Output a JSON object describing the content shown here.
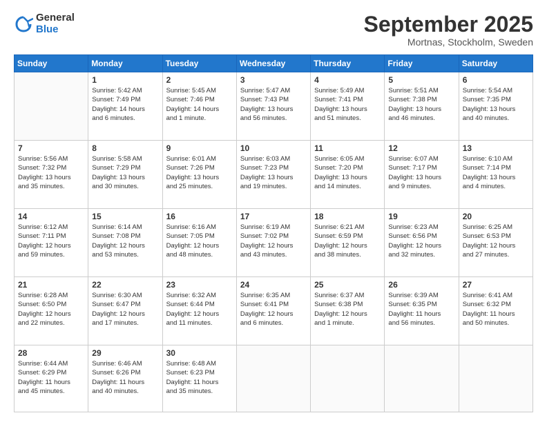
{
  "header": {
    "logo": {
      "general": "General",
      "blue": "Blue"
    },
    "title": "September 2025",
    "location": "Mortnas, Stockholm, Sweden"
  },
  "calendar": {
    "days_of_week": [
      "Sunday",
      "Monday",
      "Tuesday",
      "Wednesday",
      "Thursday",
      "Friday",
      "Saturday"
    ],
    "weeks": [
      [
        {
          "day": "",
          "info": ""
        },
        {
          "day": "1",
          "info": "Sunrise: 5:42 AM\nSunset: 7:49 PM\nDaylight: 14 hours\nand 6 minutes."
        },
        {
          "day": "2",
          "info": "Sunrise: 5:45 AM\nSunset: 7:46 PM\nDaylight: 14 hours\nand 1 minute."
        },
        {
          "day": "3",
          "info": "Sunrise: 5:47 AM\nSunset: 7:43 PM\nDaylight: 13 hours\nand 56 minutes."
        },
        {
          "day": "4",
          "info": "Sunrise: 5:49 AM\nSunset: 7:41 PM\nDaylight: 13 hours\nand 51 minutes."
        },
        {
          "day": "5",
          "info": "Sunrise: 5:51 AM\nSunset: 7:38 PM\nDaylight: 13 hours\nand 46 minutes."
        },
        {
          "day": "6",
          "info": "Sunrise: 5:54 AM\nSunset: 7:35 PM\nDaylight: 13 hours\nand 40 minutes."
        }
      ],
      [
        {
          "day": "7",
          "info": "Sunrise: 5:56 AM\nSunset: 7:32 PM\nDaylight: 13 hours\nand 35 minutes."
        },
        {
          "day": "8",
          "info": "Sunrise: 5:58 AM\nSunset: 7:29 PM\nDaylight: 13 hours\nand 30 minutes."
        },
        {
          "day": "9",
          "info": "Sunrise: 6:01 AM\nSunset: 7:26 PM\nDaylight: 13 hours\nand 25 minutes."
        },
        {
          "day": "10",
          "info": "Sunrise: 6:03 AM\nSunset: 7:23 PM\nDaylight: 13 hours\nand 19 minutes."
        },
        {
          "day": "11",
          "info": "Sunrise: 6:05 AM\nSunset: 7:20 PM\nDaylight: 13 hours\nand 14 minutes."
        },
        {
          "day": "12",
          "info": "Sunrise: 6:07 AM\nSunset: 7:17 PM\nDaylight: 13 hours\nand 9 minutes."
        },
        {
          "day": "13",
          "info": "Sunrise: 6:10 AM\nSunset: 7:14 PM\nDaylight: 13 hours\nand 4 minutes."
        }
      ],
      [
        {
          "day": "14",
          "info": "Sunrise: 6:12 AM\nSunset: 7:11 PM\nDaylight: 12 hours\nand 59 minutes."
        },
        {
          "day": "15",
          "info": "Sunrise: 6:14 AM\nSunset: 7:08 PM\nDaylight: 12 hours\nand 53 minutes."
        },
        {
          "day": "16",
          "info": "Sunrise: 6:16 AM\nSunset: 7:05 PM\nDaylight: 12 hours\nand 48 minutes."
        },
        {
          "day": "17",
          "info": "Sunrise: 6:19 AM\nSunset: 7:02 PM\nDaylight: 12 hours\nand 43 minutes."
        },
        {
          "day": "18",
          "info": "Sunrise: 6:21 AM\nSunset: 6:59 PM\nDaylight: 12 hours\nand 38 minutes."
        },
        {
          "day": "19",
          "info": "Sunrise: 6:23 AM\nSunset: 6:56 PM\nDaylight: 12 hours\nand 32 minutes."
        },
        {
          "day": "20",
          "info": "Sunrise: 6:25 AM\nSunset: 6:53 PM\nDaylight: 12 hours\nand 27 minutes."
        }
      ],
      [
        {
          "day": "21",
          "info": "Sunrise: 6:28 AM\nSunset: 6:50 PM\nDaylight: 12 hours\nand 22 minutes."
        },
        {
          "day": "22",
          "info": "Sunrise: 6:30 AM\nSunset: 6:47 PM\nDaylight: 12 hours\nand 17 minutes."
        },
        {
          "day": "23",
          "info": "Sunrise: 6:32 AM\nSunset: 6:44 PM\nDaylight: 12 hours\nand 11 minutes."
        },
        {
          "day": "24",
          "info": "Sunrise: 6:35 AM\nSunset: 6:41 PM\nDaylight: 12 hours\nand 6 minutes."
        },
        {
          "day": "25",
          "info": "Sunrise: 6:37 AM\nSunset: 6:38 PM\nDaylight: 12 hours\nand 1 minute."
        },
        {
          "day": "26",
          "info": "Sunrise: 6:39 AM\nSunset: 6:35 PM\nDaylight: 11 hours\nand 56 minutes."
        },
        {
          "day": "27",
          "info": "Sunrise: 6:41 AM\nSunset: 6:32 PM\nDaylight: 11 hours\nand 50 minutes."
        }
      ],
      [
        {
          "day": "28",
          "info": "Sunrise: 6:44 AM\nSunset: 6:29 PM\nDaylight: 11 hours\nand 45 minutes."
        },
        {
          "day": "29",
          "info": "Sunrise: 6:46 AM\nSunset: 6:26 PM\nDaylight: 11 hours\nand 40 minutes."
        },
        {
          "day": "30",
          "info": "Sunrise: 6:48 AM\nSunset: 6:23 PM\nDaylight: 11 hours\nand 35 minutes."
        },
        {
          "day": "",
          "info": ""
        },
        {
          "day": "",
          "info": ""
        },
        {
          "day": "",
          "info": ""
        },
        {
          "day": "",
          "info": ""
        }
      ]
    ]
  }
}
